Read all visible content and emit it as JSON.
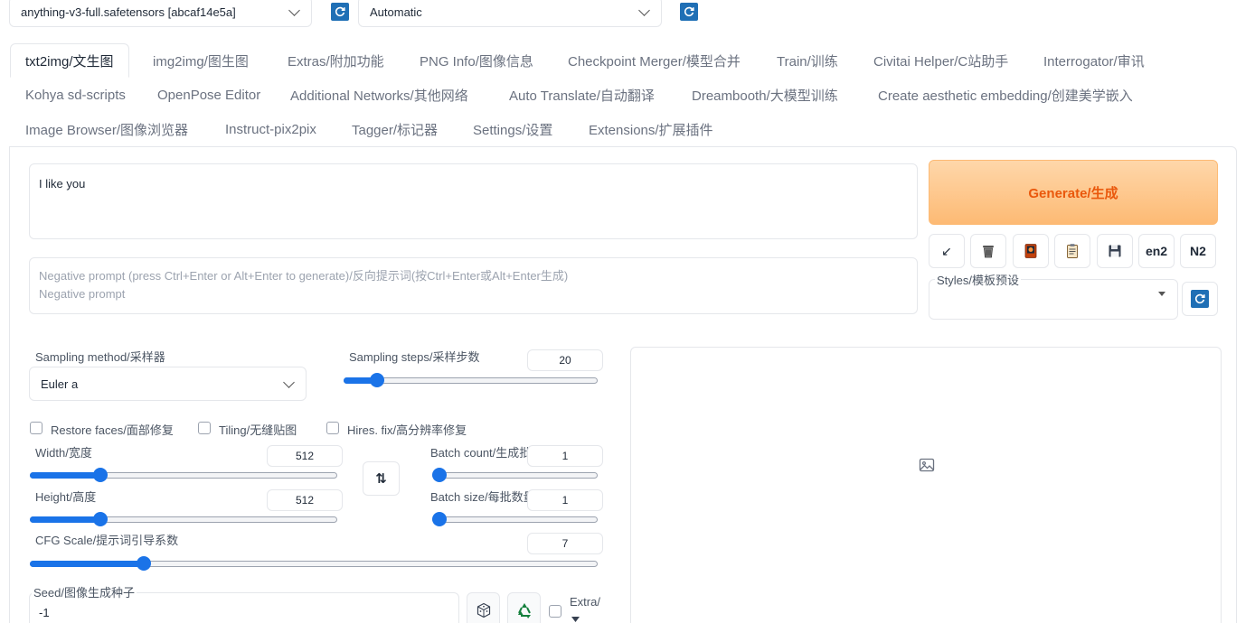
{
  "top": {
    "checkpoint": "anything-v3-full.safetensors [abcaf14e5a]",
    "vae": "Automatic"
  },
  "tabs": [
    "txt2img/文生图",
    "img2img/图生图",
    "Extras/附加功能",
    "PNG Info/图像信息",
    "Checkpoint Merger/模型合并",
    "Train/训练",
    "Civitai Helper/C站助手",
    "Interrogator/审讯",
    "Kohya sd-scripts",
    "OpenPose Editor",
    "Additional Networks/其他网络",
    "Auto Translate/自动翻译",
    "Dreambooth/大模型训练",
    "Create aesthetic embedding/创建美学嵌入",
    "Image Browser/图像浏览器",
    "Instruct-pix2pix",
    "Tagger/标记器",
    "Settings/设置",
    "Extensions/扩展插件"
  ],
  "prompt": {
    "value": "I like you",
    "negative_placeholder_1": "Negative prompt (press Ctrl+Enter or Alt+Enter to generate)/反向提示词(按Ctrl+Enter或Alt+Enter生成)",
    "negative_placeholder_2": "Negative prompt"
  },
  "generate": {
    "label": "Generate/生成"
  },
  "tools": {
    "arrow": "↙",
    "en2": "en2",
    "n2": "N2"
  },
  "styles": {
    "label": "Styles/模板预设"
  },
  "sampling": {
    "method_label": "Sampling method/采样器",
    "method_value": "Euler a",
    "steps_label": "Sampling steps/采样步数",
    "steps_value": "20",
    "steps_fraction": 0.13
  },
  "checkboxes": {
    "restore_faces": "Restore faces/面部修复",
    "tiling": "Tiling/无缝贴图",
    "hires": "Hires. fix/高分辨率修复"
  },
  "size": {
    "width_label": "Width/宽度",
    "width_value": "512",
    "width_fraction": 0.23,
    "height_label": "Height/高度",
    "height_value": "512",
    "height_fraction": 0.23
  },
  "batch": {
    "count_label": "Batch count/生成批次",
    "count_value": "1",
    "count_fraction": 0.0,
    "size_label": "Batch size/每批数量",
    "size_value": "1",
    "size_fraction": 0.0
  },
  "cfg": {
    "label": "CFG Scale/提示词引导系数",
    "value": "7",
    "fraction": 0.2
  },
  "seed": {
    "label": "Seed/图像生成种子",
    "value": "-1",
    "extra_label": "Extra/"
  },
  "colors": {
    "accent": "#1a73e8",
    "generate_text": "#ea580c",
    "refresh_blue": "#1f6fb5"
  }
}
